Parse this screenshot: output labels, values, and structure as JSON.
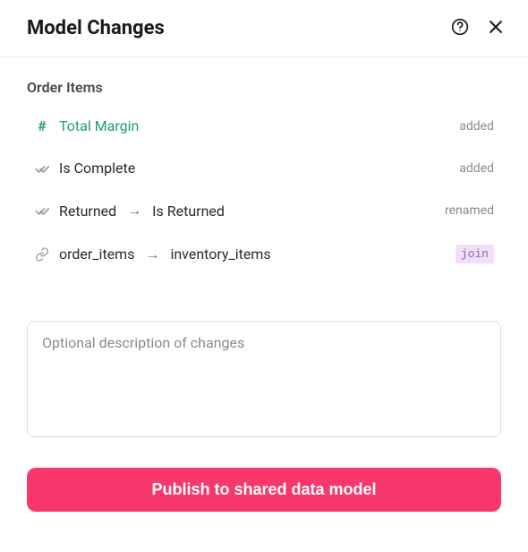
{
  "header": {
    "title": "Model Changes"
  },
  "section": {
    "title": "Order Items"
  },
  "changes": [
    {
      "icon": "measure",
      "label": "Total Margin",
      "status_type": "text",
      "status": "added",
      "measure": true
    },
    {
      "icon": "check",
      "label": "Is Complete",
      "status_type": "text",
      "status": "added",
      "measure": false
    },
    {
      "icon": "check",
      "from": "Returned",
      "to": "Is Returned",
      "status_type": "text",
      "status": "renamed",
      "measure": false
    },
    {
      "icon": "join",
      "from": "order_items",
      "to": "inventory_items",
      "status_type": "badge",
      "status": "join",
      "measure": false
    }
  ],
  "description": {
    "value": "",
    "placeholder": "Optional description of changes"
  },
  "footer": {
    "publish_label": "Publish to shared data model"
  },
  "colors": {
    "accent": "#f8376d",
    "measure": "#1f9d73",
    "badge_bg": "#f0e0f7",
    "badge_fg": "#9a5fb8"
  }
}
